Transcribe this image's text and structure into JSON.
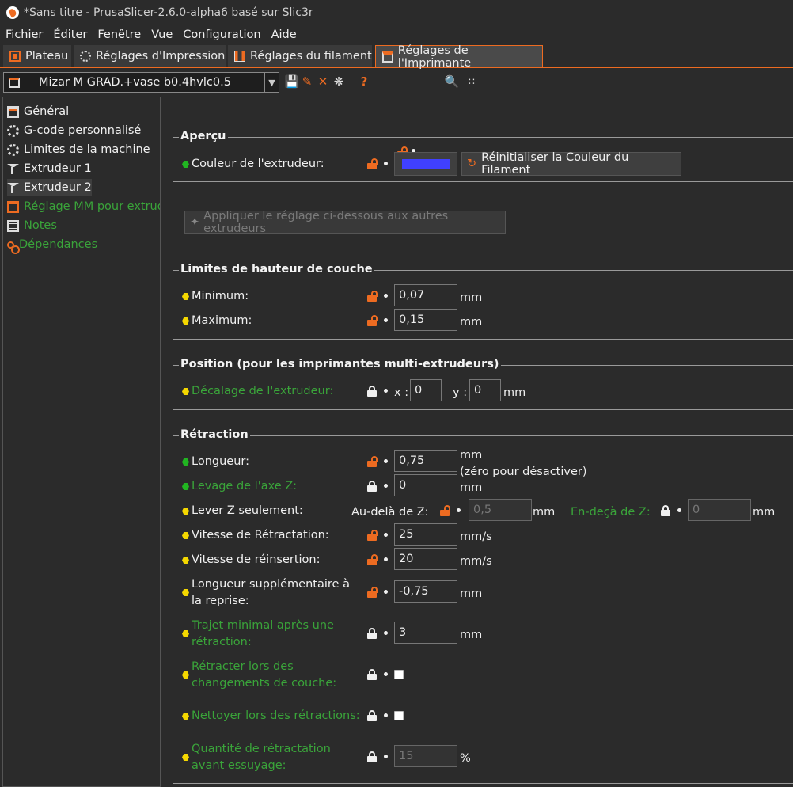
{
  "window": {
    "title": "*Sans titre - PrusaSlicer-2.6.0-alpha6 basé sur Slic3r"
  },
  "menu": [
    "Fichier",
    "Éditer",
    "Fenêtre",
    "Vue",
    "Configuration",
    "Aide"
  ],
  "tabs": [
    {
      "label": "Plateau",
      "icon": "plateau-icon"
    },
    {
      "label": "Réglages d'Impression",
      "icon": "gear-icon"
    },
    {
      "label": "Réglages du filament",
      "icon": "spool-icon"
    },
    {
      "label": "Réglages de l'Imprimante",
      "icon": "printer-icon",
      "active": true
    }
  ],
  "toolbar": {
    "preset": "Mizar M GRAD.+vase b0.4hvlc0.5",
    "help": "?"
  },
  "sidebar": {
    "items": [
      {
        "label": "Général"
      },
      {
        "label": "G-code personnalisé"
      },
      {
        "label": "Limites de la machine"
      },
      {
        "label": "Extrudeur 1"
      },
      {
        "label": "Extrudeur 2",
        "selected": true
      },
      {
        "label": "Réglage MM pour extrudeur"
      },
      {
        "label": "Notes"
      },
      {
        "label": "Dépendances"
      }
    ]
  },
  "apercu": {
    "title": "Aperçu",
    "couleur_label": "Couleur de l'extrudeur:",
    "color_value": "#4040ff",
    "reset_button": "Réinitialiser la Couleur du Filament"
  },
  "apply_button": "Appliquer le réglage ci-dessous aux autres extrudeurs",
  "layer_limits": {
    "title": "Limites de hauteur de couche",
    "min_label": "Minimum:",
    "min_value": "0,07",
    "max_label": "Maximum:",
    "max_value": "0,15",
    "unit": "mm"
  },
  "position": {
    "title": "Position (pour les imprimantes multi-extrudeurs)",
    "offset_label": "Décalage de l'extrudeur:",
    "x_label": "x :",
    "x_value": "0",
    "y_label": "y :",
    "y_value": "0",
    "unit": "mm"
  },
  "retraction": {
    "title": "Rétraction",
    "longueur_label": "Longueur:",
    "longueur_value": "0,75",
    "longueur_unit": "mm",
    "longueur_note": "(zéro pour désactiver)",
    "levage_label": "Levage de l'axe Z:",
    "levage_value": "0",
    "levage_unit": "mm",
    "lever_label": "Lever Z seulement:",
    "au_dela_label": "Au-delà de Z:",
    "au_dela_value": "0,5",
    "au_dela_unit": "mm",
    "en_deca_label": "En-deçà de Z:",
    "en_deca_value": "0",
    "en_deca_unit": "mm",
    "vitesse_retr_label": "Vitesse de Rétractation:",
    "vitesse_retr_value": "25",
    "vitesse_retr_unit": "mm/s",
    "vitesse_reins_label": "Vitesse de réinsertion:",
    "vitesse_reins_value": "20",
    "vitesse_reins_unit": "mm/s",
    "long_supp_label_1": "Longueur supplémentaire à",
    "long_supp_label_2": "la reprise:",
    "long_supp_value": "-0,75",
    "long_supp_unit": "mm",
    "trajet_label_1": "Trajet minimal après une",
    "trajet_label_2": "rétraction:",
    "trajet_value": "3",
    "trajet_unit": "mm",
    "retracter_label_1": "Rétracter lors des",
    "retracter_label_2": "changements de couche:",
    "nettoyer_label": "Nettoyer lors des rétractions:",
    "quantite_label_1": "Quantité de rétractation",
    "quantite_label_2": "avant essuyage:",
    "quantite_value": "15",
    "quantite_unit": "%"
  }
}
